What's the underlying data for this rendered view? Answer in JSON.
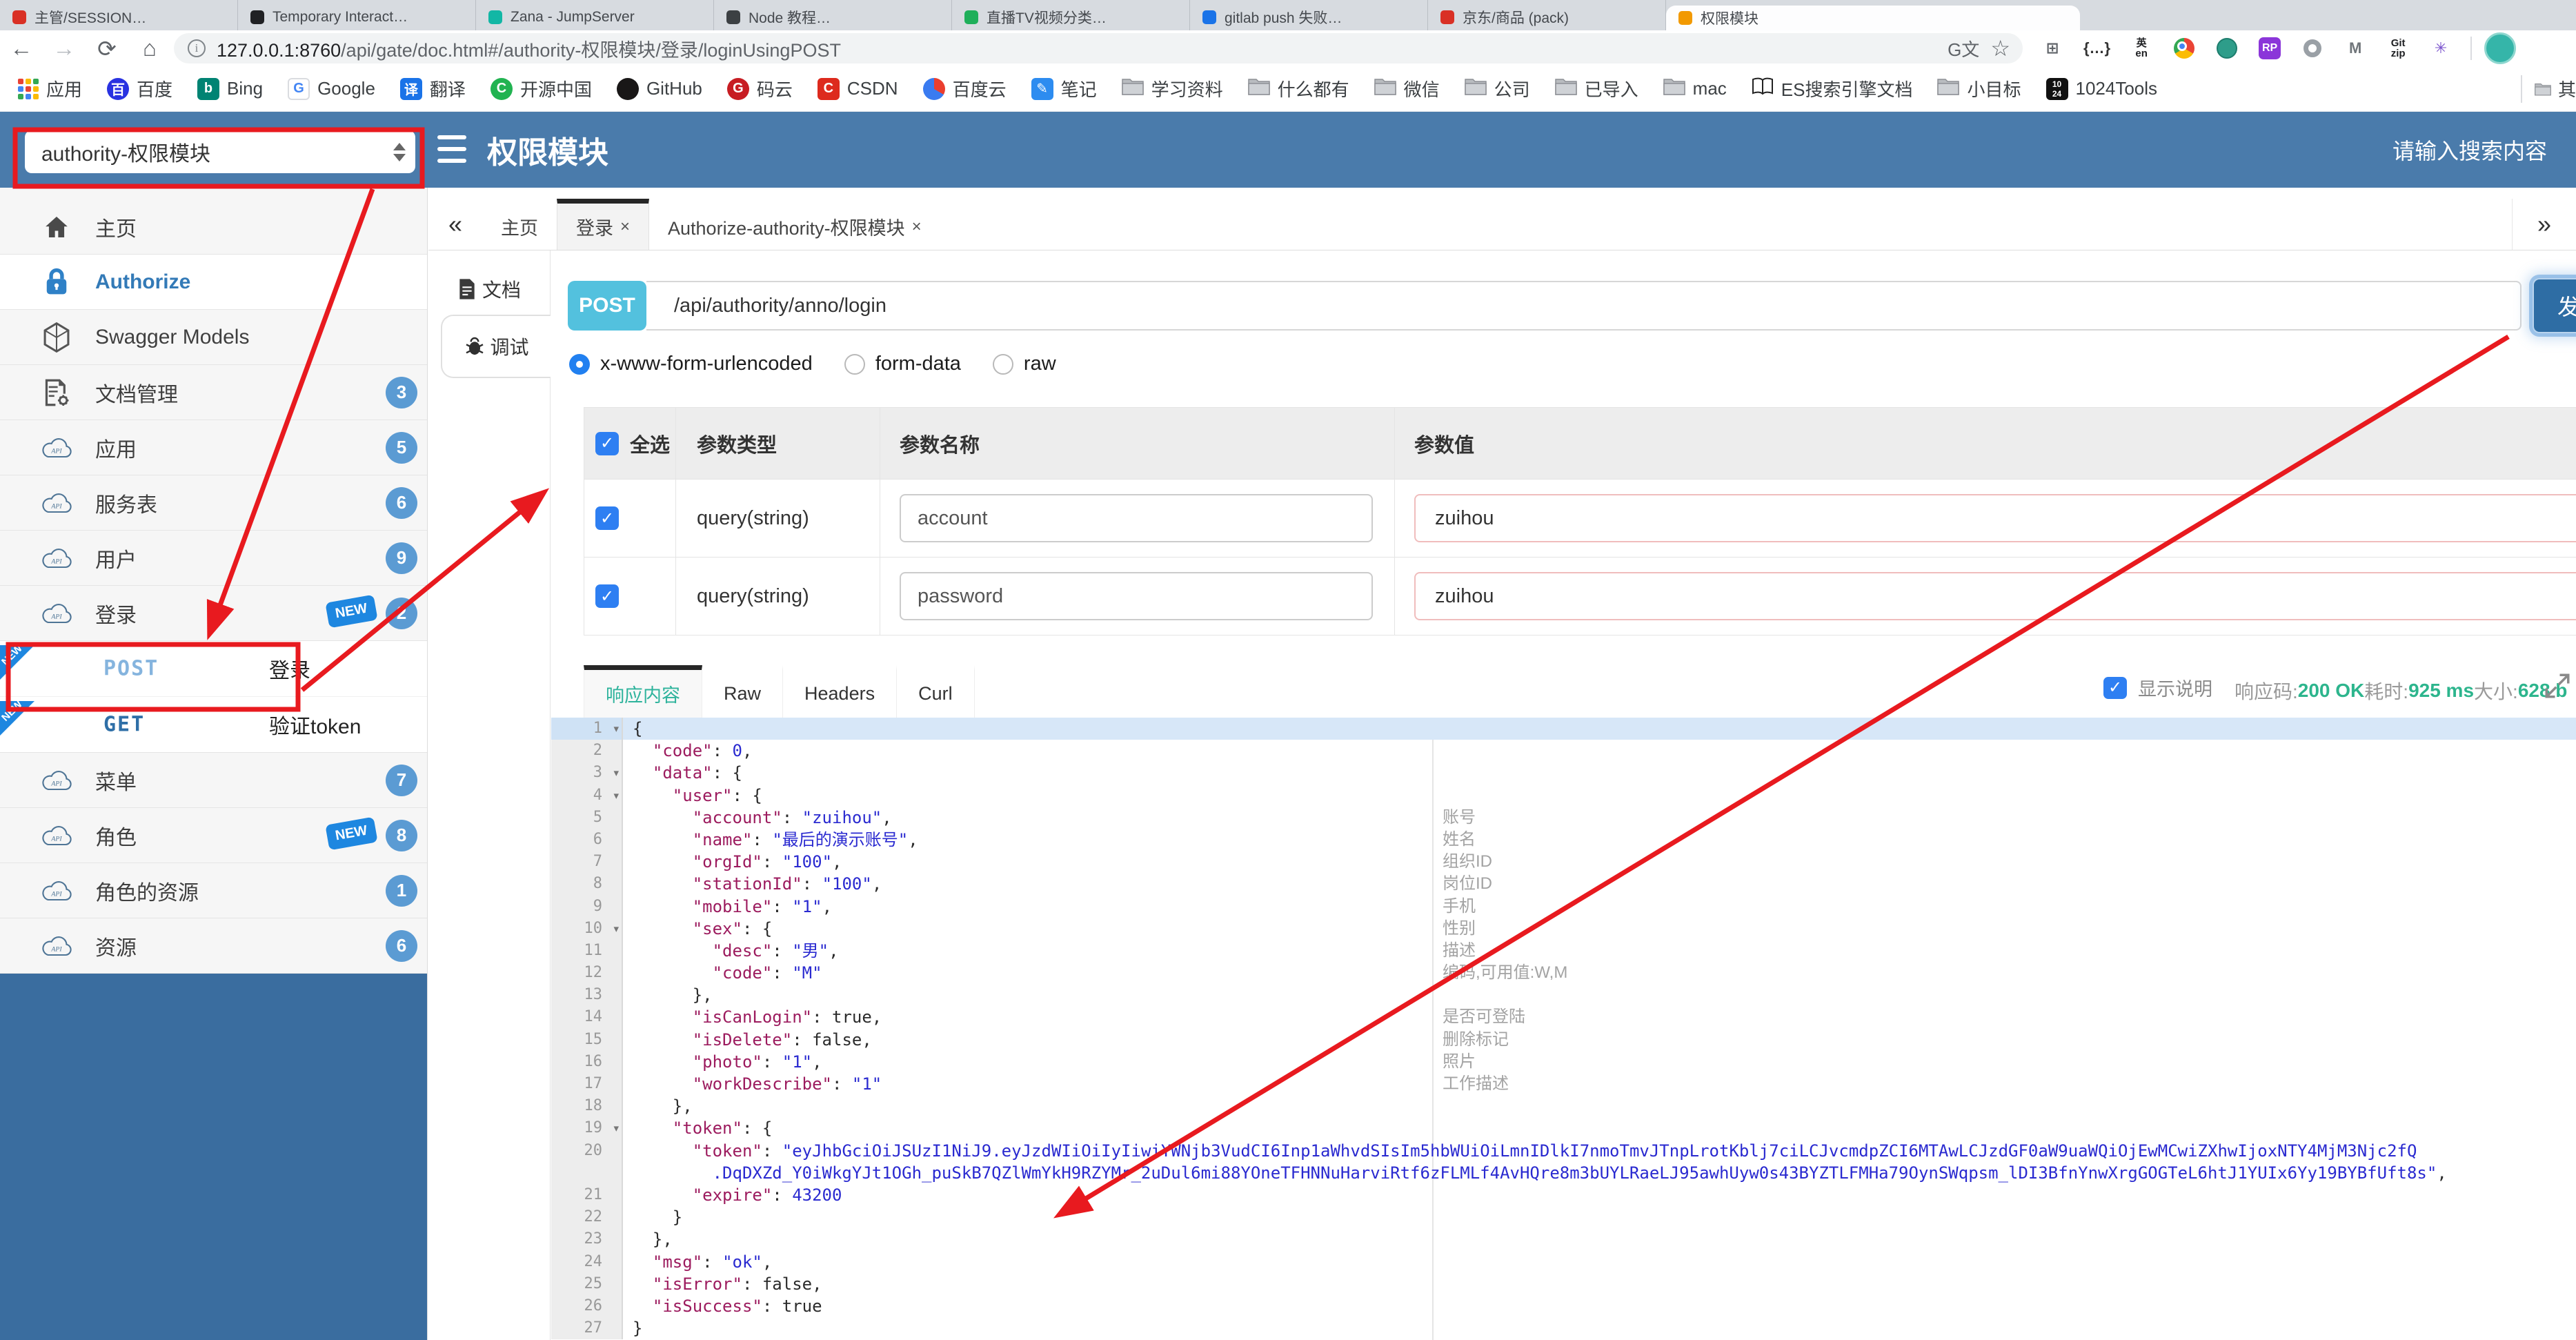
{
  "colors": {
    "header_blue": "#4a7bab",
    "sidebar_bottom_blue": "#3a6d9f",
    "badge_blue": "#5b9bd3",
    "new_tag_blue": "#1e87e0",
    "method_badge_cyan": "#53c1de",
    "send_button_blue": "#2e6da4",
    "response_ok_green": "#2db58d",
    "annotation_red": "#e81a1f",
    "json_key": "#9c1b5e",
    "json_value": "#2a2ad0"
  },
  "browser": {
    "tabs": [
      {
        "label": "主管/SESSION…",
        "color": "#d93025"
      },
      {
        "label": "Temporary Interact…",
        "color": "#202124"
      },
      {
        "label": "Zana - JumpServer",
        "color": "#12b7a5"
      },
      {
        "label": "Node 教程…",
        "color": "#3c4043"
      },
      {
        "label": "直播TV视频分类…",
        "color": "#1faf5a"
      },
      {
        "label": "gitlab push 失败…",
        "color": "#1a73e8"
      },
      {
        "label": "京东/商品 (pack)",
        "color": "#d93025"
      },
      {
        "label": "权限模块",
        "color": "#f29900",
        "active": true
      }
    ],
    "nav": {
      "back": "←",
      "forward": "→",
      "reload": "⟳",
      "home": "⌂"
    },
    "url": {
      "host": "127.0.0.1:8760",
      "path": "/api/gate/doc.html#/authority-权限模块/登录/loginUsingPOST"
    },
    "pill_icons": {
      "translate": "G文",
      "bookmark_star": "☆"
    },
    "extensions": [
      {
        "name": "apps-grid-icon",
        "kind": "glyph",
        "label": "⊞",
        "fg": "#5f6368"
      },
      {
        "name": "json-formatter-icon",
        "kind": "glyph",
        "label": "{…}",
        "fg": "#333333"
      },
      {
        "name": "translate-plugin-icon",
        "kind": "two",
        "lines": [
          "英",
          "en"
        ]
      },
      {
        "name": "chrome-icon",
        "kind": "chrome"
      },
      {
        "name": "globe-icon",
        "kind": "globe"
      },
      {
        "name": "axure-rp-icon",
        "kind": "sq",
        "bg": "#8b36d9",
        "label": "RP"
      },
      {
        "name": "ring-icon",
        "kind": "ring"
      },
      {
        "name": "m-arrow-icon",
        "kind": "glyph",
        "label": "M",
        "fg": "#70757a"
      },
      {
        "name": "gitzip-icon",
        "kind": "two",
        "lines": [
          "Git",
          "zip"
        ]
      },
      {
        "name": "asterisk-icon",
        "kind": "glyph",
        "label": "✳",
        "fg": "#7a52cc"
      }
    ],
    "bookmarks": [
      {
        "label": "应用",
        "icon": "apps"
      },
      {
        "label": "百度",
        "icon": "site",
        "bg": "#2932e1",
        "glyph": "百",
        "round": true
      },
      {
        "label": "Bing",
        "icon": "site",
        "bg": "#008373",
        "glyph": "b"
      },
      {
        "label": "Google",
        "icon": "site",
        "bg": "#ffffff",
        "glyph": "G",
        "fg": "#4285f4",
        "border": true
      },
      {
        "label": "翻译",
        "icon": "site",
        "bg": "#1a73e8",
        "glyph": "译"
      },
      {
        "label": "开源中国",
        "icon": "site",
        "bg": "#21b351",
        "glyph": "C",
        "round": true
      },
      {
        "label": "GitHub",
        "icon": "site",
        "bg": "#191717",
        "glyph": "",
        "round": true
      },
      {
        "label": "码云",
        "icon": "site",
        "bg": "#c71d23",
        "glyph": "G",
        "round": true
      },
      {
        "label": "CSDN",
        "icon": "site",
        "bg": "#dd2a1d",
        "glyph": "C"
      },
      {
        "label": "百度云",
        "icon": "yun"
      },
      {
        "label": "笔记",
        "icon": "site",
        "bg": "#2d8cf0",
        "glyph": "✎"
      },
      {
        "label": "学习资料",
        "icon": "folder"
      },
      {
        "label": "什么都有",
        "icon": "folder"
      },
      {
        "label": "微信",
        "icon": "folder"
      },
      {
        "label": "公司",
        "icon": "folder"
      },
      {
        "label": "已导入",
        "icon": "folder"
      },
      {
        "label": "mac",
        "icon": "folder"
      },
      {
        "label": "ES搜索引擎文档",
        "icon": "book"
      },
      {
        "label": "小目标",
        "icon": "folder"
      },
      {
        "label": "1024Tools",
        "icon": "b1024",
        "b1024": [
          "10",
          "24"
        ]
      }
    ],
    "bookmarks_overflow": "其"
  },
  "header": {
    "service_select": "authority-权限模块",
    "title": "权限模块",
    "search_placeholder": "请输入搜索内容"
  },
  "sidebar": {
    "items": [
      {
        "label": "主页",
        "icon": "home"
      },
      {
        "label": "Authorize",
        "icon": "lock",
        "active": true
      },
      {
        "label": "Swagger Models",
        "icon": "hex"
      },
      {
        "label": "文档管理",
        "icon": "docgear",
        "badge": "3"
      },
      {
        "label": "应用",
        "icon": "cloud",
        "badge": "5"
      },
      {
        "label": "服务表",
        "icon": "cloud",
        "badge": "6"
      },
      {
        "label": "用户",
        "icon": "cloud",
        "badge": "9"
      },
      {
        "label": "登录",
        "icon": "cloud",
        "badge": "2",
        "isNew": true,
        "sub": [
          {
            "method": "POST",
            "label": "登录",
            "ribbon": true
          },
          {
            "method": "GET",
            "label": "验证token",
            "ribbon": true
          }
        ]
      },
      {
        "label": "菜单",
        "icon": "cloud",
        "badge": "7"
      },
      {
        "label": "角色",
        "icon": "cloud",
        "badge": "8",
        "isNew": true
      },
      {
        "label": "角色的资源",
        "icon": "cloud",
        "badge": "1"
      },
      {
        "label": "资源",
        "icon": "cloud",
        "badge": "6"
      }
    ],
    "new_tag_text": "NEW"
  },
  "tabs_bar": {
    "collapse": "«",
    "expand": "»",
    "close_glyph": "×",
    "tabs": [
      {
        "label": "主页"
      },
      {
        "label": "登录",
        "close": true,
        "active": true
      },
      {
        "label": "Authorize-authority-权限模块",
        "close": true
      }
    ]
  },
  "doc_nav": {
    "doc": "文档",
    "debug": "调试"
  },
  "request": {
    "method": "POST",
    "path": "/api/authority/anno/login",
    "send_label": "发送",
    "body_types": [
      "x-www-form-urlencoded",
      "form-data",
      "raw"
    ],
    "selected_body_type": 0,
    "params_table": {
      "headers": [
        "全选",
        "参数类型",
        "参数名称",
        "参数值"
      ],
      "rows": [
        {
          "checked": true,
          "type": "query(string)",
          "name": "account",
          "value": "zuihou"
        },
        {
          "checked": true,
          "type": "query(string)",
          "name": "password",
          "value": "zuihou"
        }
      ]
    }
  },
  "response": {
    "tabs": [
      "响应内容",
      "Raw",
      "Headers",
      "Curl"
    ],
    "active_tab": 0,
    "show_desc_label": "显示说明",
    "show_desc_checked": true,
    "status": {
      "code_label": "响应码:",
      "code": "200 OK",
      "time_label": "耗时:",
      "time": "925 ms",
      "size_label": "大小:",
      "size": "628 b"
    },
    "code_rows": [
      {
        "n": "1",
        "fold": true,
        "hl": true,
        "segs": [
          [
            "p",
            "{"
          ]
        ]
      },
      {
        "n": "2",
        "segs": [
          [
            "p",
            "  "
          ],
          [
            "k",
            "\"code\""
          ],
          [
            "p",
            ": "
          ],
          [
            "num",
            "0"
          ],
          [
            "p",
            ","
          ]
        ]
      },
      {
        "n": "3",
        "fold": true,
        "segs": [
          [
            "p",
            "  "
          ],
          [
            "k",
            "\"data\""
          ],
          [
            "p",
            ": {"
          ]
        ]
      },
      {
        "n": "4",
        "fold": true,
        "segs": [
          [
            "p",
            "    "
          ],
          [
            "k",
            "\"user\""
          ],
          [
            "p",
            ": {"
          ]
        ]
      },
      {
        "n": "5",
        "ann": "账号",
        "segs": [
          [
            "p",
            "      "
          ],
          [
            "k",
            "\"account\""
          ],
          [
            "p",
            ": "
          ],
          [
            "s",
            "\"zuihou\""
          ],
          [
            "p",
            ","
          ]
        ]
      },
      {
        "n": "6",
        "ann": "姓名",
        "segs": [
          [
            "p",
            "      "
          ],
          [
            "k",
            "\"name\""
          ],
          [
            "p",
            ": "
          ],
          [
            "s",
            "\"最后的演示账号\""
          ],
          [
            "p",
            ","
          ]
        ]
      },
      {
        "n": "7",
        "ann": "组织ID",
        "segs": [
          [
            "p",
            "      "
          ],
          [
            "k",
            "\"orgId\""
          ],
          [
            "p",
            ": "
          ],
          [
            "s",
            "\"100\""
          ],
          [
            "p",
            ","
          ]
        ]
      },
      {
        "n": "8",
        "ann": "岗位ID",
        "segs": [
          [
            "p",
            "      "
          ],
          [
            "k",
            "\"stationId\""
          ],
          [
            "p",
            ": "
          ],
          [
            "s",
            "\"100\""
          ],
          [
            "p",
            ","
          ]
        ]
      },
      {
        "n": "9",
        "ann": "手机",
        "segs": [
          [
            "p",
            "      "
          ],
          [
            "k",
            "\"mobile\""
          ],
          [
            "p",
            ": "
          ],
          [
            "s",
            "\"1\""
          ],
          [
            "p",
            ","
          ]
        ]
      },
      {
        "n": "10",
        "fold": true,
        "ann": "性别",
        "segs": [
          [
            "p",
            "      "
          ],
          [
            "k",
            "\"sex\""
          ],
          [
            "p",
            ": {"
          ]
        ]
      },
      {
        "n": "11",
        "ann": "描述",
        "segs": [
          [
            "p",
            "        "
          ],
          [
            "k",
            "\"desc\""
          ],
          [
            "p",
            ": "
          ],
          [
            "s",
            "\"男\""
          ],
          [
            "p",
            ","
          ]
        ]
      },
      {
        "n": "12",
        "ann": "编码,可用值:W,M",
        "segs": [
          [
            "p",
            "        "
          ],
          [
            "k",
            "\"code\""
          ],
          [
            "p",
            ": "
          ],
          [
            "s",
            "\"M\""
          ]
        ]
      },
      {
        "n": "13",
        "segs": [
          [
            "p",
            "      },"
          ]
        ]
      },
      {
        "n": "14",
        "ann": "是否可登陆",
        "segs": [
          [
            "p",
            "      "
          ],
          [
            "k",
            "\"isCanLogin\""
          ],
          [
            "p",
            ": "
          ],
          [
            "b",
            "true"
          ],
          [
            "p",
            ","
          ]
        ]
      },
      {
        "n": "15",
        "ann": "删除标记",
        "segs": [
          [
            "p",
            "      "
          ],
          [
            "k",
            "\"isDelete\""
          ],
          [
            "p",
            ": "
          ],
          [
            "b",
            "false"
          ],
          [
            "p",
            ","
          ]
        ]
      },
      {
        "n": "16",
        "ann": "照片",
        "segs": [
          [
            "p",
            "      "
          ],
          [
            "k",
            "\"photo\""
          ],
          [
            "p",
            ": "
          ],
          [
            "s",
            "\"1\""
          ],
          [
            "p",
            ","
          ]
        ]
      },
      {
        "n": "17",
        "ann": "工作描述",
        "segs": [
          [
            "p",
            "      "
          ],
          [
            "k",
            "\"workDescribe\""
          ],
          [
            "p",
            ": "
          ],
          [
            "s",
            "\"1\""
          ]
        ]
      },
      {
        "n": "18",
        "segs": [
          [
            "p",
            "    },"
          ]
        ]
      },
      {
        "n": "19",
        "fold": true,
        "segs": [
          [
            "p",
            "    "
          ],
          [
            "k",
            "\"token\""
          ],
          [
            "p",
            ": {"
          ]
        ]
      },
      {
        "n": "20",
        "segs": [
          [
            "p",
            "      "
          ],
          [
            "k",
            "\"token\""
          ],
          [
            "p",
            ": "
          ],
          [
            "s",
            "\"eyJhbGciOiJSUzI1NiJ9.eyJzdWIiOiIyIiwiYWNjb3VudCI6Inp1aWhvdSIsIm5hbWUiOiLmnIDlkI7nmoTmvJTnpLrotKblj7ciLCJvcmdpZCI6MTAwLCJzdGF0aW9uaWQiOjEwMCwiZXhwIjoxNTY4MjM3Njc2fQ"
          ]
        ]
      },
      {
        "segs": [
          [
            "s",
            "        .DqDXZd_Y0iWkgYJt1OGh_puSkB7QZlWmYkH9RZYMr_2uDul6mi88YOneTFHNNuHarviRtf6zFLMLf4AvHQre8m3bUYLRaeLJ95awhUyw0s43BYZTLFMHa79OynSWqpsm_lDI3BfnYnwXrgGOGTeL6htJ1YUIx6Yy19BYBfUft8s\""
          ],
          [
            "p",
            ","
          ]
        ]
      },
      {
        "n": "21",
        "segs": [
          [
            "p",
            "      "
          ],
          [
            "k",
            "\"expire\""
          ],
          [
            "p",
            ": "
          ],
          [
            "num",
            "43200"
          ]
        ]
      },
      {
        "n": "22",
        "segs": [
          [
            "p",
            "    }"
          ]
        ]
      },
      {
        "n": "23",
        "segs": [
          [
            "p",
            "  },"
          ]
        ]
      },
      {
        "n": "24",
        "segs": [
          [
            "p",
            "  "
          ],
          [
            "k",
            "\"msg\""
          ],
          [
            "p",
            ": "
          ],
          [
            "s",
            "\"ok\""
          ],
          [
            "p",
            ","
          ]
        ]
      },
      {
        "n": "25",
        "segs": [
          [
            "p",
            "  "
          ],
          [
            "k",
            "\"isError\""
          ],
          [
            "p",
            ": "
          ],
          [
            "b",
            "false"
          ],
          [
            "p",
            ","
          ]
        ]
      },
      {
        "n": "26",
        "segs": [
          [
            "p",
            "  "
          ],
          [
            "k",
            "\"isSuccess\""
          ],
          [
            "p",
            ": "
          ],
          [
            "b",
            "true"
          ]
        ]
      },
      {
        "n": "27",
        "segs": [
          [
            "p",
            "}"
          ]
        ]
      }
    ]
  }
}
